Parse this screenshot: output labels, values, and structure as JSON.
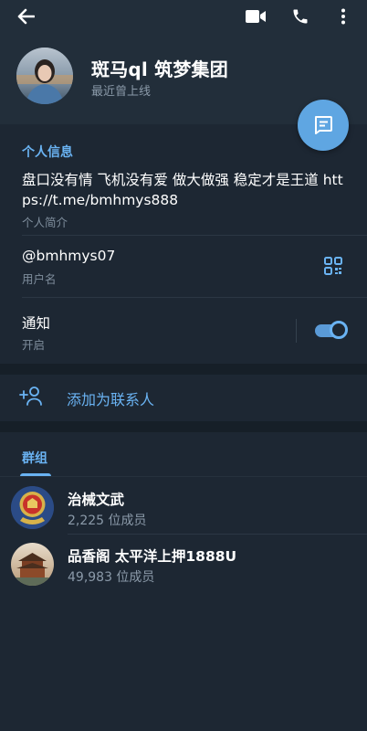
{
  "header": {
    "back_icon": "arrow-left-icon",
    "video_icon": "video-call-icon",
    "call_icon": "phone-icon",
    "menu_icon": "more-vertical-icon"
  },
  "profile": {
    "name": "斑马ql 筑梦集团",
    "status": "最近曾上线",
    "avatar": "user-avatar-photo"
  },
  "fab": {
    "icon": "message-icon"
  },
  "info": {
    "title": "个人信息",
    "bio": "盘口没有情 飞机没有爱 做大做强 稳定才是王道 https://t.me/bmhmys888",
    "bio_label": "个人简介",
    "username": "@bmhmys07",
    "username_label": "用户名",
    "qr_icon": "qr-code-icon",
    "notify_label": "通知",
    "notify_state": "开启"
  },
  "add_contact": {
    "label": "添加为联系人",
    "icon": "add-person-icon"
  },
  "groups": {
    "tab_label": "群组",
    "items": [
      {
        "name": "治械文武",
        "members": "2,225 位成员"
      },
      {
        "name": "品香阁 太平洋上押1888U",
        "members": "49,983 位成员"
      }
    ]
  },
  "colors": {
    "accent": "#6ab3f3",
    "background": "#1d2733",
    "header_bg": "#222e3a",
    "fab_bg": "#5fa6e2"
  }
}
